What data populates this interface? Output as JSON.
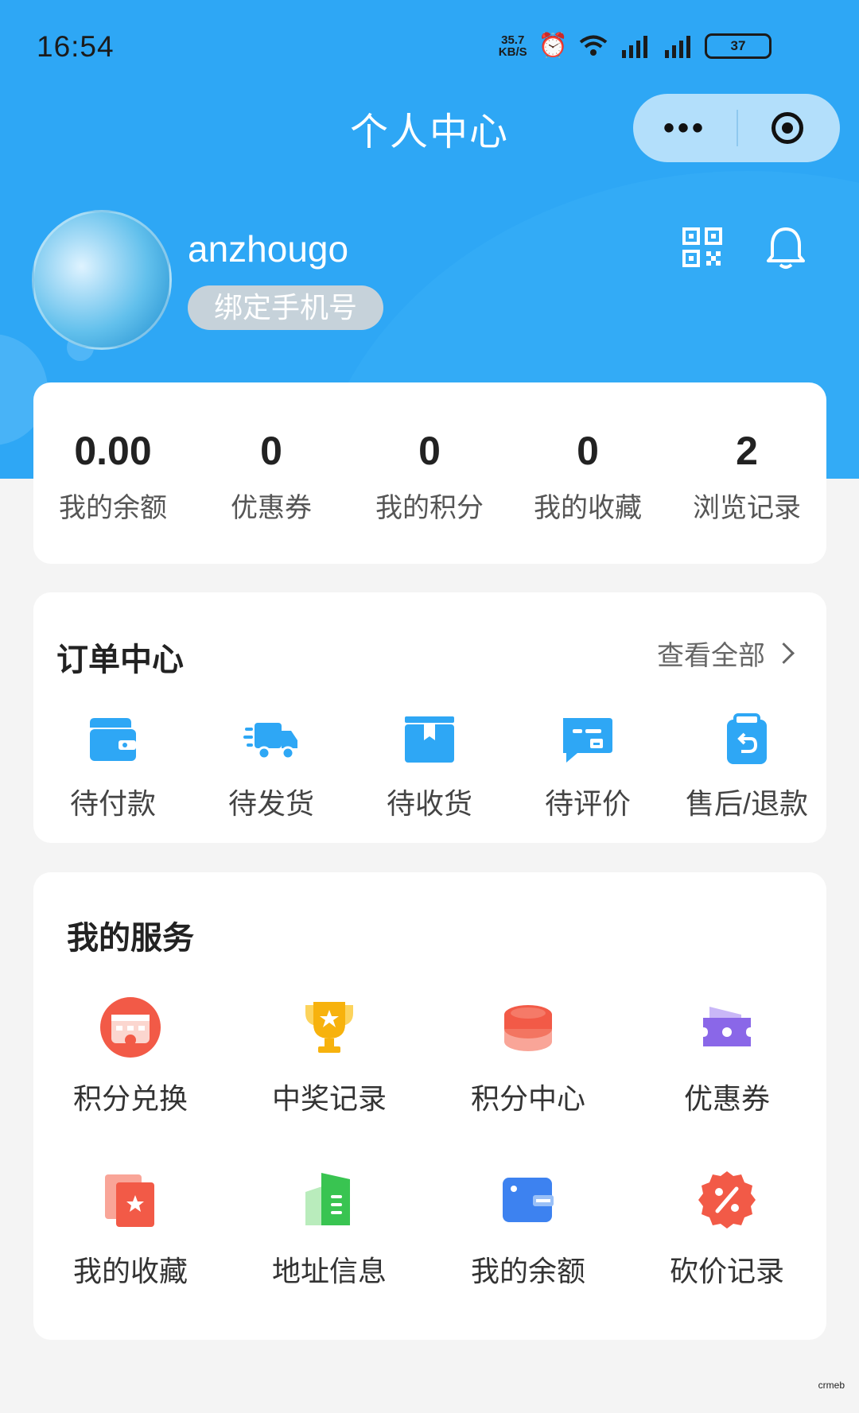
{
  "status_bar": {
    "time": "16:54",
    "speed_value": "35.7",
    "speed_unit": "KB/S",
    "battery": "37"
  },
  "header": {
    "title": "个人中心",
    "capsule_more": "•••"
  },
  "profile": {
    "username": "anzhougo",
    "bind_phone": "绑定手机号"
  },
  "stats": [
    {
      "value": "0.00",
      "label": "我的余额"
    },
    {
      "value": "0",
      "label": "优惠券"
    },
    {
      "value": "0",
      "label": "我的积分"
    },
    {
      "value": "0",
      "label": "我的收藏"
    },
    {
      "value": "2",
      "label": "浏览记录"
    }
  ],
  "orders": {
    "title": "订单中心",
    "view_all": "查看全部",
    "items": [
      {
        "label": "待付款",
        "icon": "wallet-icon"
      },
      {
        "label": "待发货",
        "icon": "truck-icon"
      },
      {
        "label": "待收货",
        "icon": "box-icon"
      },
      {
        "label": "待评价",
        "icon": "comment-icon"
      },
      {
        "label": "售后/退款",
        "icon": "refund-icon"
      }
    ],
    "accent": "#2ea7f5"
  },
  "services": {
    "title": "我的服务",
    "items": [
      {
        "label": "积分兑换",
        "icon": "points-exchange-icon"
      },
      {
        "label": "中奖记录",
        "icon": "trophy-icon"
      },
      {
        "label": "积分中心",
        "icon": "coin-stack-icon"
      },
      {
        "label": "优惠券",
        "icon": "coupon-icon"
      },
      {
        "label": "我的收藏",
        "icon": "favorite-star-icon"
      },
      {
        "label": "地址信息",
        "icon": "address-icon"
      },
      {
        "label": "我的余额",
        "icon": "balance-card-icon"
      },
      {
        "label": "砍价记录",
        "icon": "discount-badge-icon"
      }
    ]
  },
  "watermark": "crmeb",
  "colors": {
    "header_bg": "#2ea7f5",
    "page_bg": "#f4f4f4"
  }
}
